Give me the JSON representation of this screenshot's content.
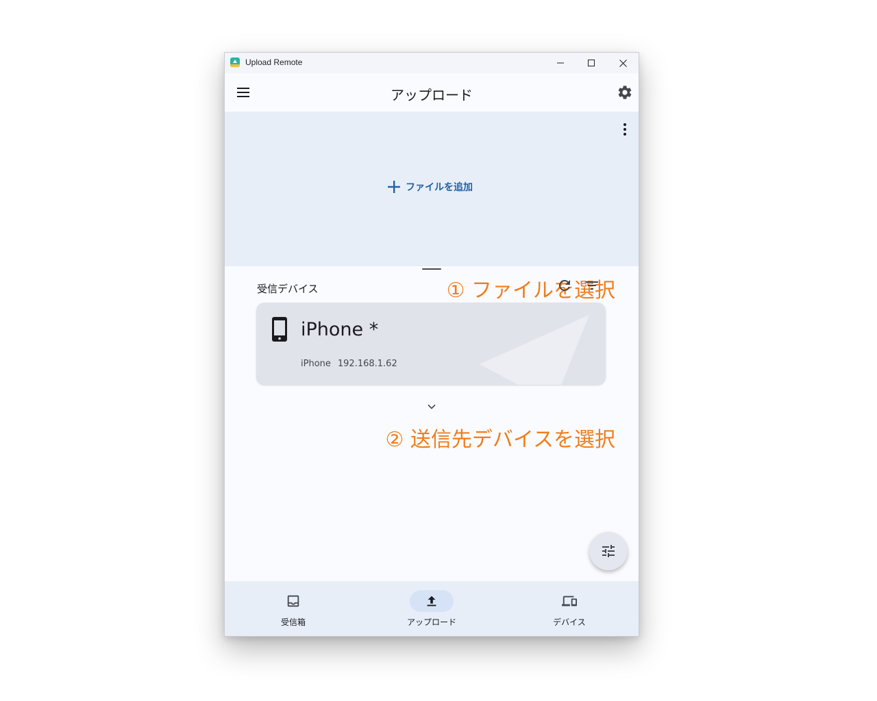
{
  "window": {
    "title": "Upload Remote"
  },
  "appbar": {
    "title": "アップロード"
  },
  "upload_area": {
    "add_file_label": "ファイルを追加"
  },
  "annotations": {
    "step1": "① ファイルを選択",
    "step2": "② 送信先デバイスを選択",
    "color": "#f07d1c"
  },
  "devices_section": {
    "label": "受信デバイス",
    "devices": [
      {
        "name": "iPhone *",
        "model": "iPhone",
        "ip": "192.168.1.62",
        "icon": "smartphone-icon"
      }
    ]
  },
  "bottom_nav": {
    "items": [
      {
        "label": "受信箱",
        "icon": "inbox-icon",
        "active": false
      },
      {
        "label": "アップロード",
        "icon": "upload-icon",
        "active": true
      },
      {
        "label": "デバイス",
        "icon": "devices-icon",
        "active": false
      }
    ]
  },
  "colors": {
    "accent": "#2061a3",
    "upload_area_bg": "#e8eef8",
    "card_bg": "#e1e3eb",
    "nav_active_pill": "#d6e3f7"
  }
}
